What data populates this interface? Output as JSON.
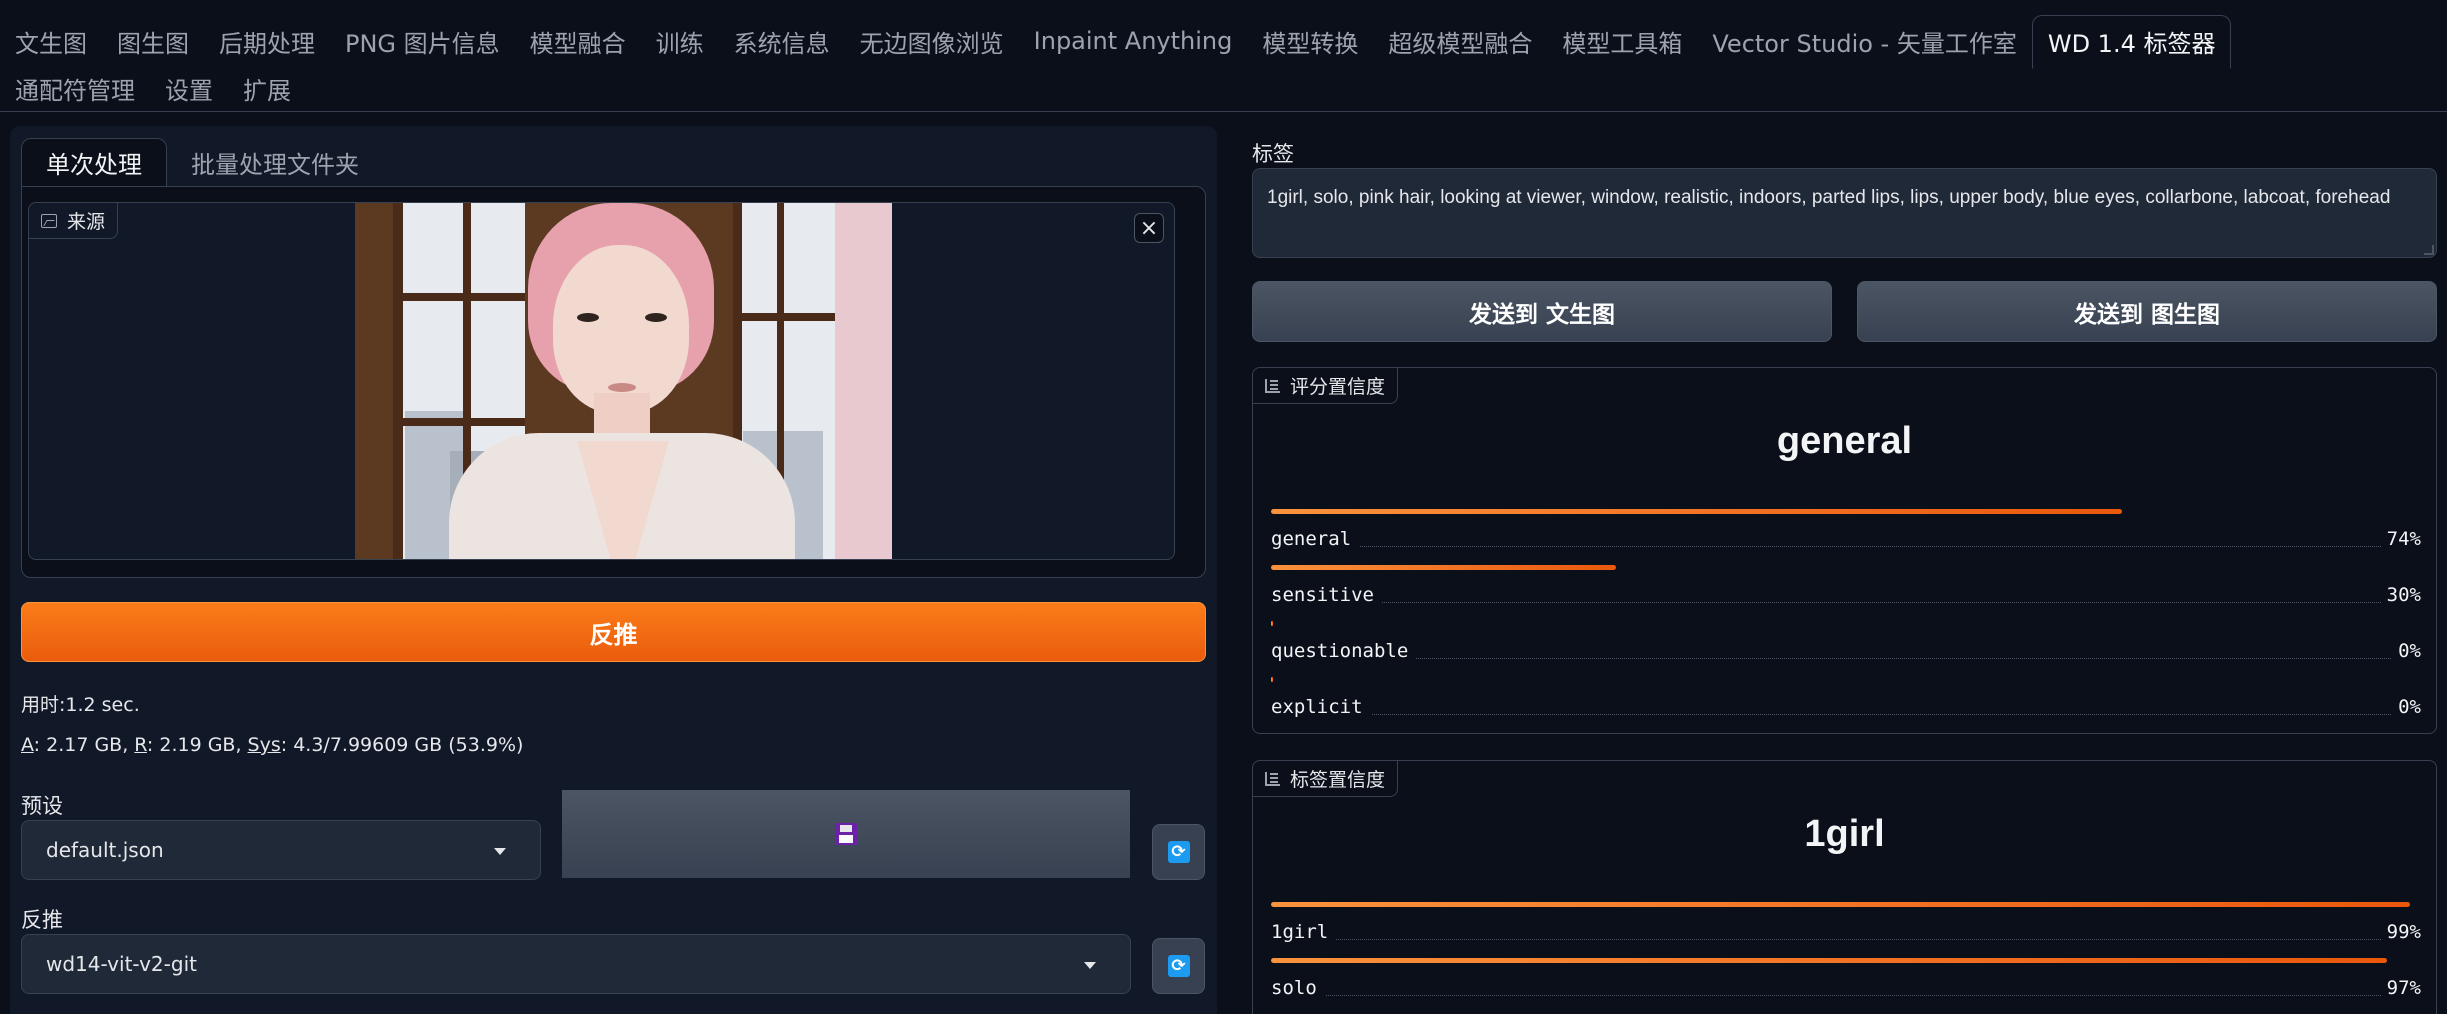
{
  "tabs": {
    "row1": [
      "文生图",
      "图生图",
      "后期处理",
      "PNG 图片信息",
      "模型融合",
      "训练",
      "系统信息",
      "无边图像浏览",
      "Inpaint Anything",
      "模型转换",
      "超级模型融合",
      "模型工具箱",
      "Vector Studio - 矢量工作室",
      "WD 1.4 标签器"
    ],
    "row2": [
      "通配符管理",
      "设置",
      "扩展"
    ],
    "active": "WD 1.4 标签器"
  },
  "left": {
    "subtabs": [
      "单次处理",
      "批量处理文件夹"
    ],
    "source_label": "来源",
    "close_glyph": "×",
    "interrogate_button": "反推",
    "time_prefix": "用时:",
    "time_value": "1.2 sec.",
    "mem": {
      "a_label": "A",
      "a_value": ": 2.17 GB, ",
      "r_label": "R",
      "r_value": ": 2.19 GB, ",
      "sys_label": "Sys",
      "sys_value": ": 4.3/7.99609 GB (53.9%)"
    },
    "preset_label": "预设",
    "preset_value": "default.json",
    "interrogator_label": "反推",
    "interrogator_value": "wd14-vit-v2-git"
  },
  "right": {
    "tags_label": "标签",
    "tags_value": "1girl, solo, pink hair, looking at viewer, window, realistic, indoors, parted lips, lips, upper body, blue eyes, collarbone, labcoat, forehead",
    "send_txt2img": "发送到 文生图",
    "send_img2img": "发送到 图生图",
    "rating": {
      "title": "评分置信度",
      "top": "general",
      "items": [
        {
          "name": "general",
          "pct": "74%",
          "value": 0.74
        },
        {
          "name": "sensitive",
          "pct": "30%",
          "value": 0.3
        },
        {
          "name": "questionable",
          "pct": "0%",
          "value": 0.0
        },
        {
          "name": "explicit",
          "pct": "0%",
          "value": 0.0
        }
      ]
    },
    "tag_conf": {
      "title": "标签置信度",
      "top": "1girl",
      "items": [
        {
          "name": "1girl",
          "pct": "99%",
          "value": 0.99
        },
        {
          "name": "solo",
          "pct": "97%",
          "value": 0.97
        }
      ]
    }
  },
  "colors": {
    "accent": "#ea580c",
    "background": "#0b0f19",
    "panel": "#111827"
  }
}
